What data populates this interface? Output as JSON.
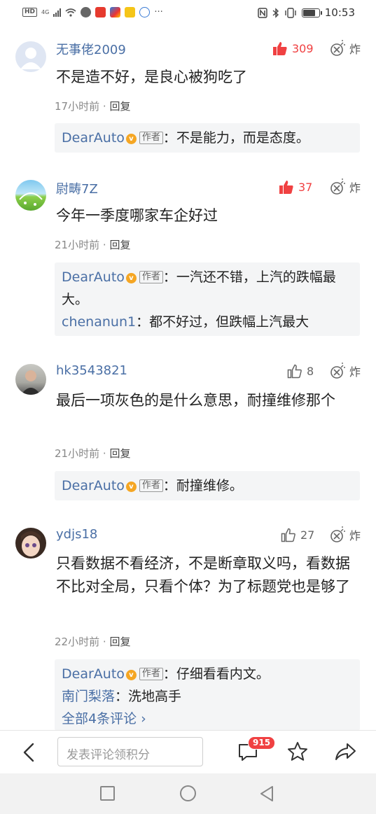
{
  "status_bar": {
    "left_icons": [
      "hd-icon",
      "4g-signal-icon",
      "wifi-icon",
      "app-icon-1",
      "news-app-icon",
      "browser-app-icon",
      "notes-app-icon",
      "paw-app-icon"
    ],
    "hd_label": "HD",
    "network_label": "4G",
    "more_label": "···",
    "right_icons": [
      "nfc-icon",
      "bluetooth-icon",
      "vibrate-icon",
      "battery-icon"
    ],
    "time": "10:53"
  },
  "comments": [
    {
      "username": "无事佬2009",
      "likes": "309",
      "liked_style": "hot",
      "bomb_label": "炸",
      "text": "不是造不好，是良心被狗吃了",
      "time": "17小时前",
      "dot": "·",
      "reply_label": "回复",
      "replies": [
        {
          "name": "DearAuto",
          "is_author": true,
          "author_tag": "作者",
          "sep": "：",
          "text": "不是能力，而是态度。"
        }
      ]
    },
    {
      "username": "尉畴7Z",
      "likes": "37",
      "liked_style": "hot",
      "bomb_label": "炸",
      "text": "今年一季度哪家车企好过",
      "time": "21小时前",
      "dot": "·",
      "reply_label": "回复",
      "replies": [
        {
          "name": "DearAuto",
          "is_author": true,
          "author_tag": "作者",
          "sep": "：",
          "text": "一汽还不错，上汽的跌幅最大。"
        },
        {
          "name": "chenanun1",
          "is_author": false,
          "sep": "：",
          "text": "都不好过，但跌幅上汽最大"
        }
      ]
    },
    {
      "username": "hk3543821",
      "likes": "8",
      "liked_style": "cold",
      "bomb_label": "炸",
      "text": "最后一项灰色的是什么意思，耐撞维修那个",
      "time": "21小时前",
      "dot": "·",
      "reply_label": "回复",
      "replies": [
        {
          "name": "DearAuto",
          "is_author": true,
          "author_tag": "作者",
          "sep": "：",
          "text": "耐撞维修。"
        }
      ]
    },
    {
      "username": "ydjs18",
      "likes": "27",
      "liked_style": "cold",
      "bomb_label": "炸",
      "text": "只看数据不看经济，不是断章取义吗，看数据不比对全局，只看个体？为了标题党也是够了",
      "time": "22小时前",
      "dot": "·",
      "reply_label": "回复",
      "replies": [
        {
          "name": "DearAuto",
          "is_author": true,
          "author_tag": "作者",
          "sep": "：",
          "text": "仔细看看内文。"
        },
        {
          "name": "南门梨落",
          "is_author": false,
          "sep": "：",
          "text": "洗地高手"
        }
      ],
      "more_replies": "全部4条评论 ›"
    }
  ],
  "bottom_bar": {
    "input_placeholder": "发表评论领积分",
    "comment_count": "915"
  },
  "colors": {
    "link_blue": "#4a6fa5",
    "like_red": "#f04142",
    "reply_bg": "#f4f5f6",
    "verified_orange": "#f5a623"
  }
}
